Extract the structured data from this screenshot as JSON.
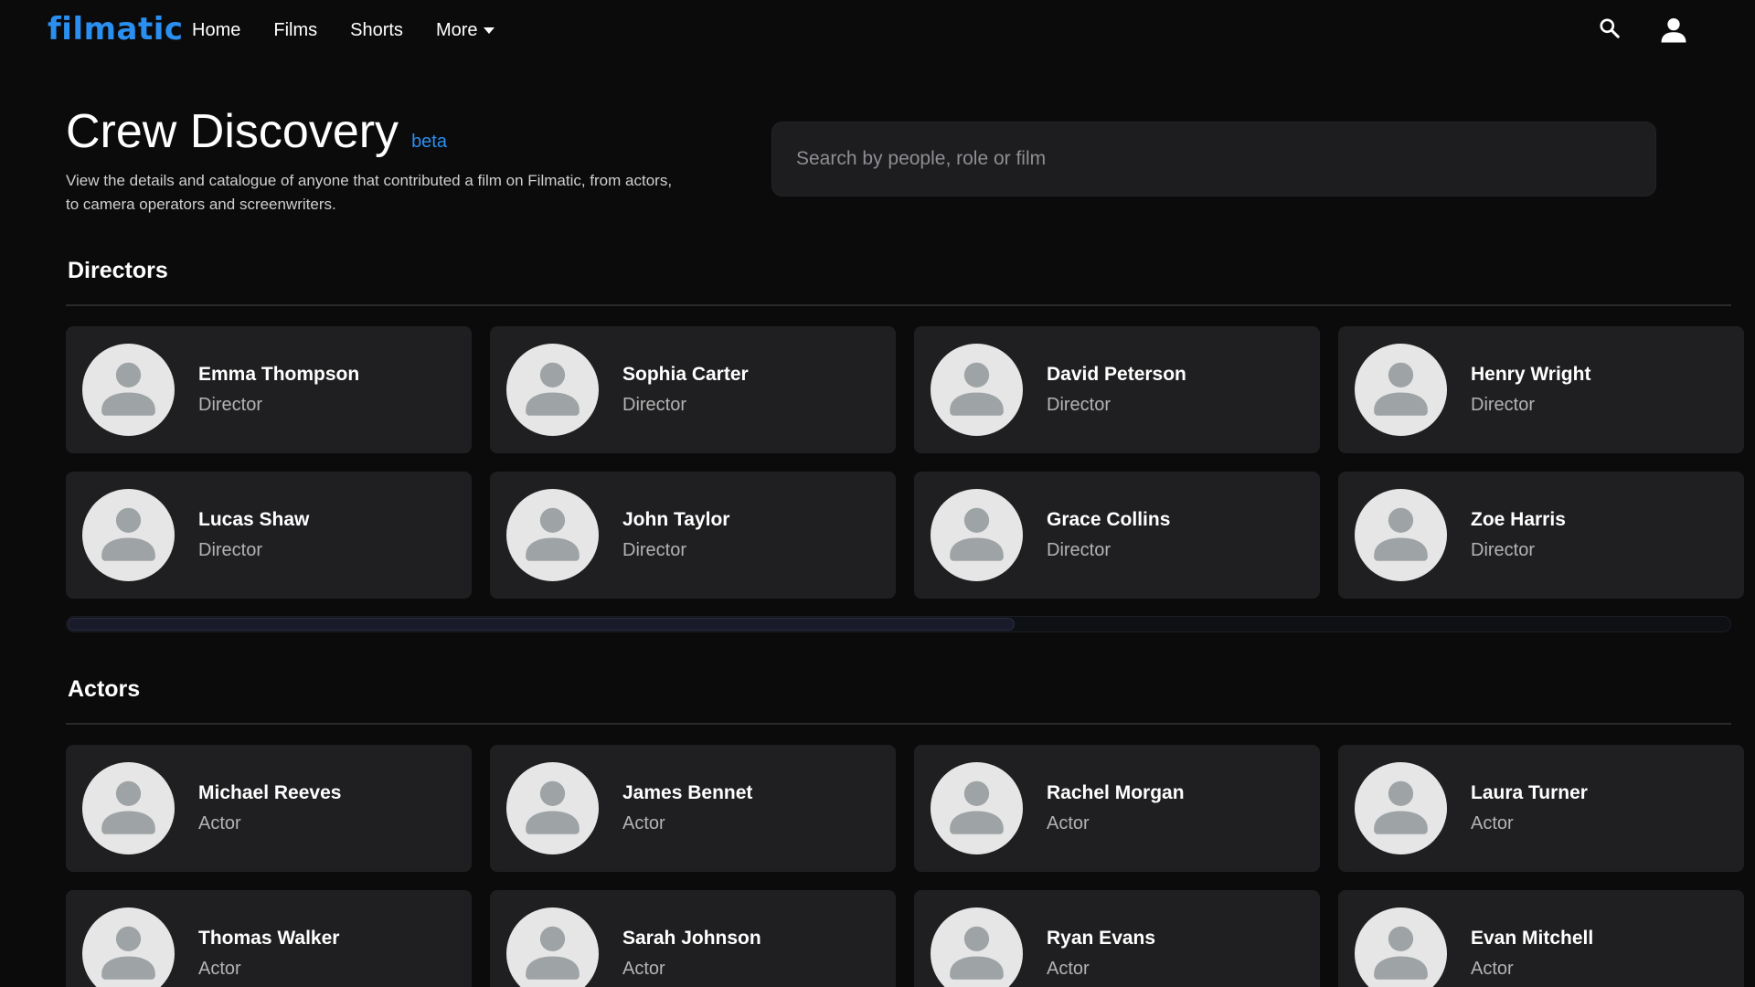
{
  "app": {
    "logo": "filmatic",
    "nav": [
      {
        "label": "Home"
      },
      {
        "label": "Films"
      },
      {
        "label": "Shorts"
      },
      {
        "label": "More"
      }
    ],
    "search_icon": "search-icon",
    "user_icon": "user-icon"
  },
  "page": {
    "title": "Crew Discovery",
    "badge": "beta",
    "description": "View the details and catalogue of anyone that contributed a film on Filmatic, from actors, to camera operators and screenwriters.",
    "search_placeholder": "Search by people, role or film"
  },
  "directors": {
    "title": "Directors",
    "scroll_position": 0.57,
    "people": [
      {
        "name": "Emma Thompson",
        "role": "Director"
      },
      {
        "name": "Sophia Carter",
        "role": "Director"
      },
      {
        "name": "David Peterson",
        "role": "Director"
      },
      {
        "name": "Henry Wright",
        "role": "Director"
      },
      {
        "name": "Lucas Shaw",
        "role": "Director"
      },
      {
        "name": "John Taylor",
        "role": "Director"
      },
      {
        "name": "Grace Collins",
        "role": "Director"
      },
      {
        "name": "Zoe Harris",
        "role": "Director"
      }
    ]
  },
  "actors": {
    "title": "Actors",
    "people": [
      {
        "name": "Michael Reeves",
        "role": "Actor"
      },
      {
        "name": "James Bennet",
        "role": "Actor"
      },
      {
        "name": "Rachel Morgan",
        "role": "Actor"
      },
      {
        "name": "Laura Turner",
        "role": "Actor"
      },
      {
        "name": "Thomas Walker",
        "role": "Actor"
      },
      {
        "name": "Sarah Johnson",
        "role": "Actor"
      },
      {
        "name": "Ryan Evans",
        "role": "Actor"
      },
      {
        "name": "Evan Mitchell",
        "role": "Actor"
      }
    ]
  },
  "colors": {
    "accent": "#2b8ff0",
    "background": "#0b0b0c",
    "card": "#1f1f21",
    "avatar": "#e6e6e6",
    "avatar_figure": "#9ea3a6"
  }
}
